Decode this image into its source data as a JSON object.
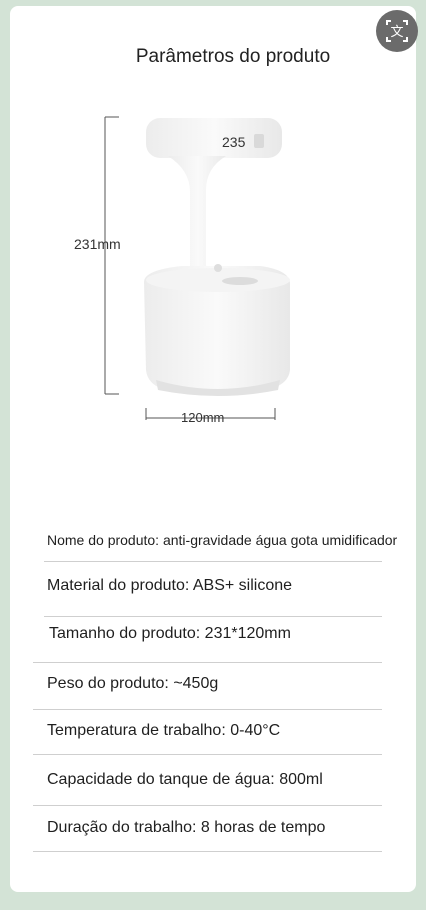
{
  "title": "Parâmetros do produto",
  "dimensions": {
    "height_label": "231mm",
    "width_label": "120mm",
    "display_label": "235"
  },
  "translate_button": {
    "icon": "translate-icon",
    "glyph": "文"
  },
  "specs": [
    "Nome do produto: anti-gravidade água gota umidificador",
    "Material do produto: ABS+ silicone",
    "Tamanho do produto: 231*120mm",
    "Peso do produto: ~450g",
    "Temperatura de trabalho: 0-40°C",
    "Capacidade do tanque de água: 800ml",
    "Duração do trabalho: 8 horas de tempo"
  ],
  "colors": {
    "background": "#d3e3d6",
    "card": "#ffffff",
    "button": "#6b6b6b"
  }
}
